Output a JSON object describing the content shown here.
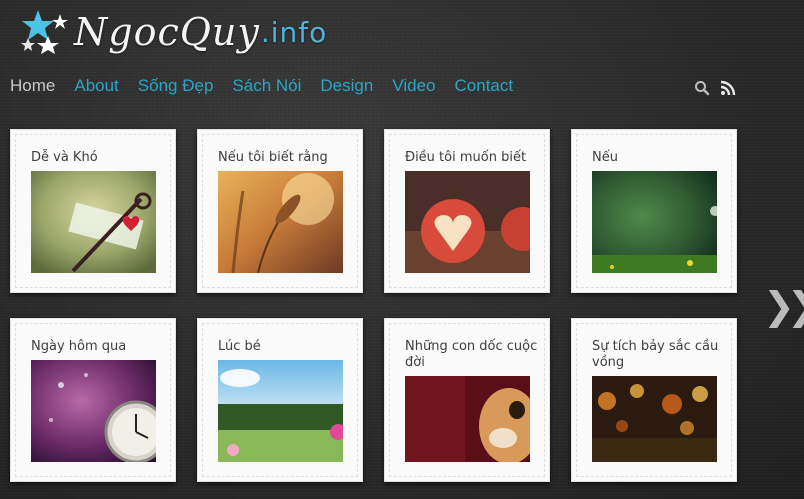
{
  "site": {
    "logo_name": "NgocQuy",
    "logo_tld": ".info"
  },
  "nav": {
    "items": [
      {
        "label": "Home",
        "active": true
      },
      {
        "label": "About",
        "active": false
      },
      {
        "label": "Sống Đẹp",
        "active": false
      },
      {
        "label": "Sách Nói",
        "active": false
      },
      {
        "label": "Design",
        "active": false
      },
      {
        "label": "Video",
        "active": false
      },
      {
        "label": "Contact",
        "active": false
      }
    ],
    "tools": [
      "search-icon",
      "rss-icon"
    ]
  },
  "posts": [
    {
      "title": "Dễ và Khó",
      "image": "key-with-heart-photo"
    },
    {
      "title": "Nếu tôi biết rằng",
      "image": "wheat-grass-sunlight-photo"
    },
    {
      "title": "Điều tôi muốn biết",
      "image": "apple-heart-cutout-photo"
    },
    {
      "title": "Nếu",
      "image": "green-bokeh-grass-photo"
    },
    {
      "title": "Ngày hôm qua",
      "image": "pocket-watch-purple-photo"
    },
    {
      "title": "Lúc bé",
      "image": "meadow-sky-flowers-photo"
    },
    {
      "title": "Những con dốc cuộc đời",
      "image": "kitten-peeking-photo"
    },
    {
      "title": "Sự tích bảy sắc cầu vồng",
      "image": "autumn-bokeh-photo"
    }
  ],
  "pager": {
    "next_label": "❯❯"
  },
  "colors": {
    "link": "#2aa6c4",
    "active_link": "#c8c8c8",
    "tld": "#4fb3d9",
    "background": "#2b2b2b"
  }
}
